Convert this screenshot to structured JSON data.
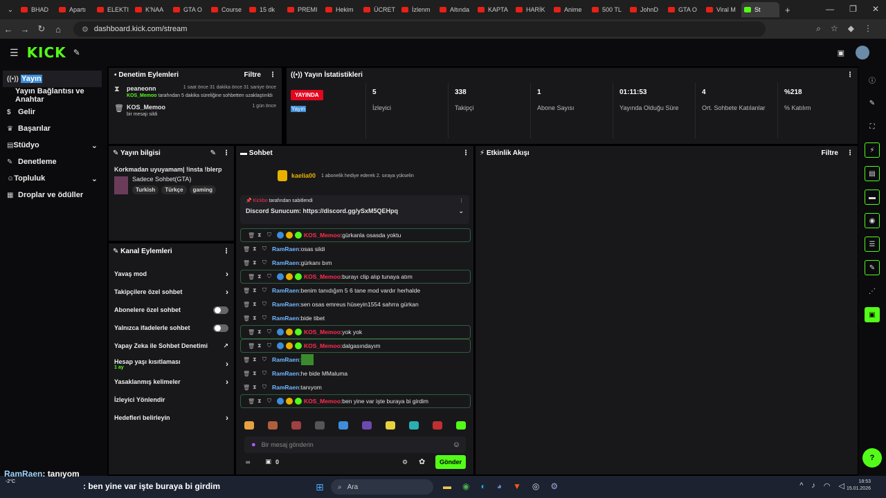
{
  "browser": {
    "tabs": [
      "BHAD",
      "Apartı",
      "ELEKTI",
      "K'NAA",
      "GTA O",
      "Course",
      "15 dk",
      "PREMI",
      "Hekim",
      "ÜCRET",
      "İzlenm",
      "Altında",
      "KAPTA",
      "HARİK",
      "Anime",
      "500 TL",
      "JohnD",
      "GTA O",
      "Viral M",
      "St"
    ],
    "url": "dashboard.kick.com/stream"
  },
  "app": {
    "logo": "KICK"
  },
  "sidebar": {
    "items": [
      {
        "label": "Yayın",
        "icon": "broadcast-icon"
      },
      {
        "label": "Yayın Bağlantısı ve Anahtar",
        "icon": ""
      },
      {
        "label": "Gelir",
        "icon": "dollar-icon"
      },
      {
        "label": "Başarılar",
        "icon": "trophy-icon"
      },
      {
        "label": "Stüdyo",
        "icon": "layout-icon"
      },
      {
        "label": "Denetleme",
        "icon": "wrench-icon"
      },
      {
        "label": "Topluluk",
        "icon": "users-icon"
      },
      {
        "label": "Droplar ve ödüller",
        "icon": "gift-icon"
      }
    ]
  },
  "mod_actions": {
    "title": "Denetim Eylemleri",
    "filter": "Filtre",
    "entries": [
      {
        "user": "peaneonn",
        "time": "1 saat önce 31 dakika önce 31 saniye önce",
        "detail_user": "KOS_Memoo",
        "detail": "tarafından 5 dakika süreliğine sohbetten uzaklaştırıldı"
      },
      {
        "user": "KOS_Memoo",
        "time": "1 gün önce",
        "detail_user": "",
        "detail": "bir mesajı sildi"
      }
    ]
  },
  "stats": {
    "title": "Yayın İstatistikleri",
    "live_badge": "YAYINDA",
    "live_sub": "Yayın",
    "items": [
      {
        "value": "5",
        "label": "İzleyici"
      },
      {
        "value": "338",
        "label": "Takipçi"
      },
      {
        "value": "1",
        "label": "Abone Sayısı"
      },
      {
        "value": "01:11:53",
        "label": "Yayında Olduğu Süre"
      },
      {
        "value": "4",
        "label": "Ort. Sohbete Katılanlar"
      },
      {
        "value": "%218",
        "label": "% Katılım"
      }
    ]
  },
  "stream_info": {
    "title": "Yayın bilgisi",
    "stream_title": "Korkmadan uyuyamam| !insta !blerp",
    "category": "Sadece Sohbet(GTA)",
    "tags": [
      "Turkish",
      "Türkçe",
      "gaming"
    ]
  },
  "channel_actions": {
    "title": "Kanal Eylemleri",
    "items": [
      {
        "label": "Yavaş mod",
        "control": "chevron"
      },
      {
        "label": "Takipçilere özel sohbet",
        "control": "chevron"
      },
      {
        "label": "Abonelere özel sohbet",
        "control": "toggle"
      },
      {
        "label": "Yalnızca ifadelerle sohbet",
        "control": "toggle"
      },
      {
        "label": "Yapay Zeka ile Sohbet Denetimi",
        "control": "external"
      },
      {
        "label": "Hesap yaşı kısıtlaması",
        "sub": "1 ay",
        "control": "chevron"
      },
      {
        "label": "Yasaklanmış kelimeler",
        "control": "chevron"
      },
      {
        "label": "İzleyici Yönlendir",
        "control": "none"
      },
      {
        "label": "Hedefleri belirleyin",
        "control": "chevron"
      }
    ]
  },
  "chat": {
    "title": "Sohbet",
    "gift_user": "kaelia00",
    "gift_text": "1 abonelik hediye ederek 2. sıraya yükselin",
    "pinned_by_user": "Kickbo",
    "pinned_by": "tarafından sabitlendi",
    "pinned_message": "Discord Sunucum: https://discord.gg/ySxM5QEHpq",
    "messages": [
      {
        "user": "KOS_Memoo",
        "text": "gürkanla osasda yoktu",
        "boxed": true
      },
      {
        "user": "RamRaen",
        "text": "osas sildi",
        "boxed": false
      },
      {
        "user": "RamRaen",
        "text": "gürkanı bım",
        "boxed": false
      },
      {
        "user": "KOS_Memoo",
        "text": "burayı clip alıp tunaya atım",
        "boxed": true
      },
      {
        "user": "RamRaen",
        "text": "benim tanıdığım 5 6 tane mod vardır herhalde",
        "boxed": false
      },
      {
        "user": "RamRaen",
        "text": "sen osas emreus hüseyin1554 sahrra gürkan",
        "boxed": false
      },
      {
        "user": "RamRaen",
        "text": "bide tibet",
        "boxed": false
      },
      {
        "user": "KOS_Memoo",
        "text": "yok yok",
        "boxed": true
      },
      {
        "user": "KOS_Memoo",
        "text": "dalgasındayım",
        "boxed": true
      },
      {
        "user": "RamRaen",
        "text": "",
        "boxed": false
      },
      {
        "user": "RamRaen",
        "text": "he bide MMaluma",
        "boxed": false
      },
      {
        "user": "RamRaen",
        "text": "tanıyom",
        "boxed": false
      },
      {
        "user": "KOS_Memoo",
        "text": "ben yine var işte buraya bi girdim",
        "boxed": true
      }
    ],
    "input_placeholder": "Bir mesaj gönderin",
    "points": "0",
    "send_label": "Gönder"
  },
  "activity": {
    "title": "Etkinlik Akışı",
    "filter": "Filtre"
  },
  "overlay": {
    "line1_user": "RamRaen",
    "line1_text": ": tanıyom",
    "line2_text": ": ben yine var işte buraya bi girdim",
    "weather": "-2°C"
  },
  "taskbar": {
    "search": "Ara",
    "time": "18:53",
    "date": "15.01.2026"
  }
}
